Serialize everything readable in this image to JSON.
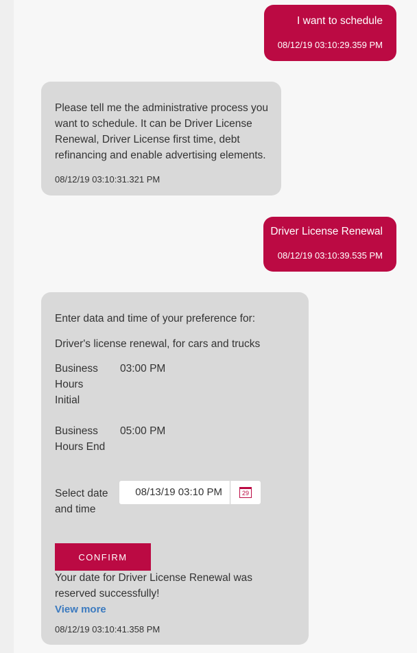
{
  "messages": {
    "user1": {
      "text": "I want to schedule",
      "time": "08/12/19 03:10:29.359 PM"
    },
    "bot1": {
      "text": "Please tell me the administrative process you want to schedule. It can be Driver License Renewal, Driver License first time, debt refinancing and enable advertising elements.",
      "time": "08/12/19 03:10:31.321 PM"
    },
    "user2": {
      "text": "Driver License Renewal",
      "time": "08/12/19 03:10:39.535 PM"
    },
    "bot2": {
      "intro": "Enter data and time of your preference for:",
      "service": "Driver's license renewal, for cars and trucks",
      "hours_initial_label": "Business Hours Initial",
      "hours_initial_value": "03:00 PM",
      "hours_end_label": "Business Hours End",
      "hours_end_value": "05:00 PM",
      "select_label": "Select date and time",
      "selected_datetime": "08/13/19 03:10 PM",
      "calendar_day": "29",
      "confirm_label": "CONFIRM",
      "result_text": "Your date for Driver License Renewal was reserved successfully!",
      "view_more": "View more",
      "time": "08/12/19 03:10:41.358 PM"
    }
  },
  "colors": {
    "accent": "#bb0a43",
    "bot_bubble": "#d9d9d9",
    "link": "#3b7abf"
  }
}
